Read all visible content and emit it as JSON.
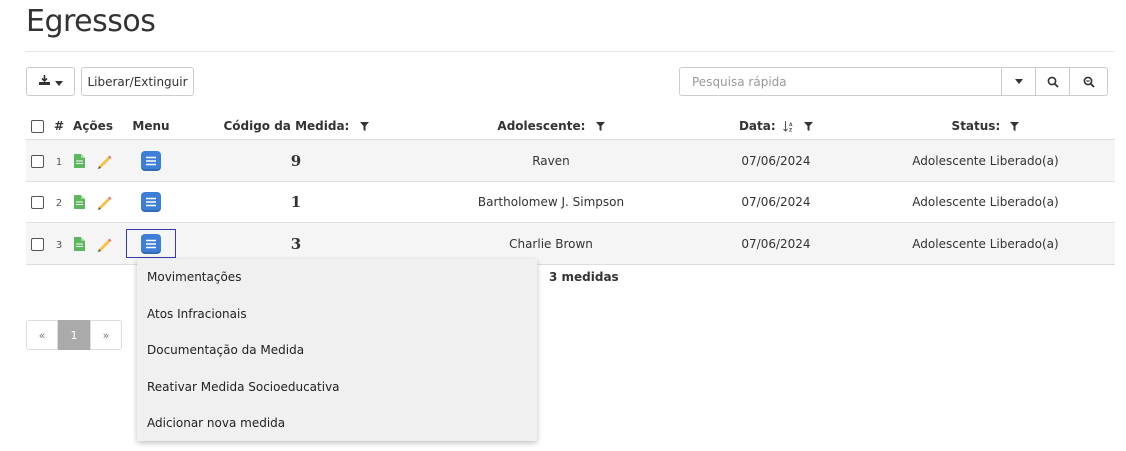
{
  "page": {
    "title": "Egressos"
  },
  "toolbar": {
    "liberar_label": "Liberar/Extinguir"
  },
  "search": {
    "placeholder": "Pesquisa rápida"
  },
  "table": {
    "headers": {
      "num": "#",
      "acoes": "Ações",
      "menu": "Menu",
      "codigo": "Código da Medida:",
      "adolescente": "Adolescente:",
      "data": "Data:",
      "status": "Status:"
    },
    "rows": [
      {
        "num": "1",
        "codigo": "9",
        "adolescente": "Raven",
        "data": "07/06/2024",
        "status": "Adolescente Liberado(a)"
      },
      {
        "num": "2",
        "codigo": "1",
        "adolescente": "Bartholomew J. Simpson",
        "data": "07/06/2024",
        "status": "Adolescente Liberado(a)"
      },
      {
        "num": "3",
        "codigo": "3",
        "adolescente": "Charlie Brown",
        "data": "07/06/2024",
        "status": "Adolescente Liberado(a)"
      }
    ],
    "count_label": "3 medidas"
  },
  "pagination": {
    "prev": "«",
    "current": "1",
    "next": "»"
  },
  "menu_dropdown": {
    "items": [
      "Movimentações",
      "Atos Infracionais",
      "Documentação da Medida",
      "Reativar Medida Socioeducativa",
      "Adicionar nova medida"
    ]
  },
  "colors": {
    "menu_icon": "#3d7fd6",
    "doc_icon": "#5cb85c",
    "pencil_icon": "#f0ad4e",
    "focus_border": "#3a3aa8"
  }
}
